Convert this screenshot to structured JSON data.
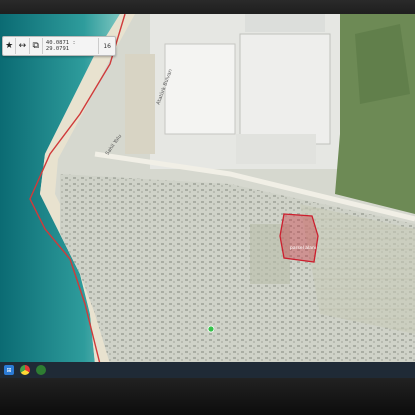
{
  "toolbar": {
    "star_icon": "star-icon",
    "measure_icon": "ruler-icon",
    "layers_icon": "layers-icon",
    "coordinates": "40.0871 : 29.0791",
    "zoom": "16"
  },
  "map": {
    "road_label_1": "Atatürk Bulvarı",
    "road_label_2": "Sahil Yolu",
    "parcel_label": "parsel alanı",
    "boundary_color": "#d03a3a",
    "parcel_color": "#cc1f2e"
  },
  "taskbar": {
    "start_icon": "windows-start-icon",
    "browser_icon": "chrome-icon",
    "app_icon": "app-icon"
  }
}
